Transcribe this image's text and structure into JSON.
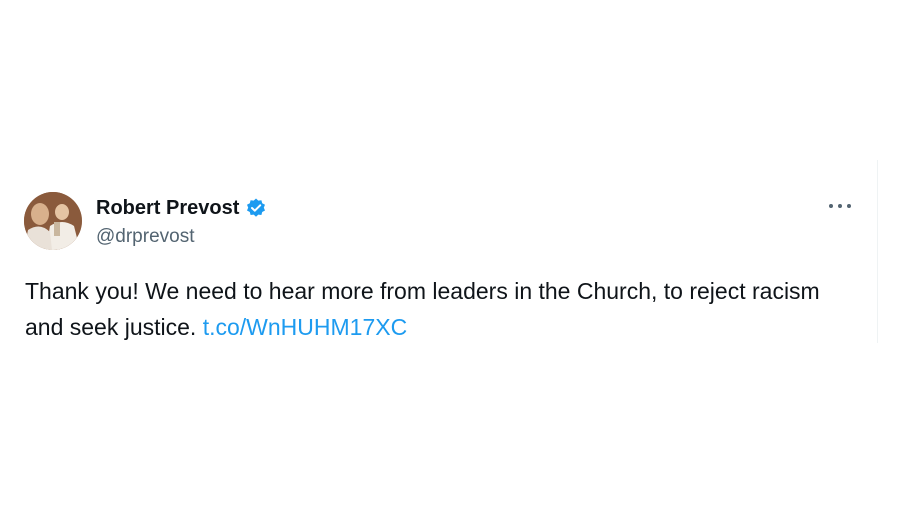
{
  "tweet": {
    "author": {
      "display_name": "Robert Prevost",
      "handle": "@drprevost",
      "verified": true,
      "verified_color": "#1d9bf0"
    },
    "text": "Thank you! We need to hear more from leaders in the Church, to reject racism and seek justice.",
    "link": "t.co/WnHUHM17XC",
    "link_color": "#1d9bf0",
    "more_icon": "more-horizontal-icon"
  }
}
